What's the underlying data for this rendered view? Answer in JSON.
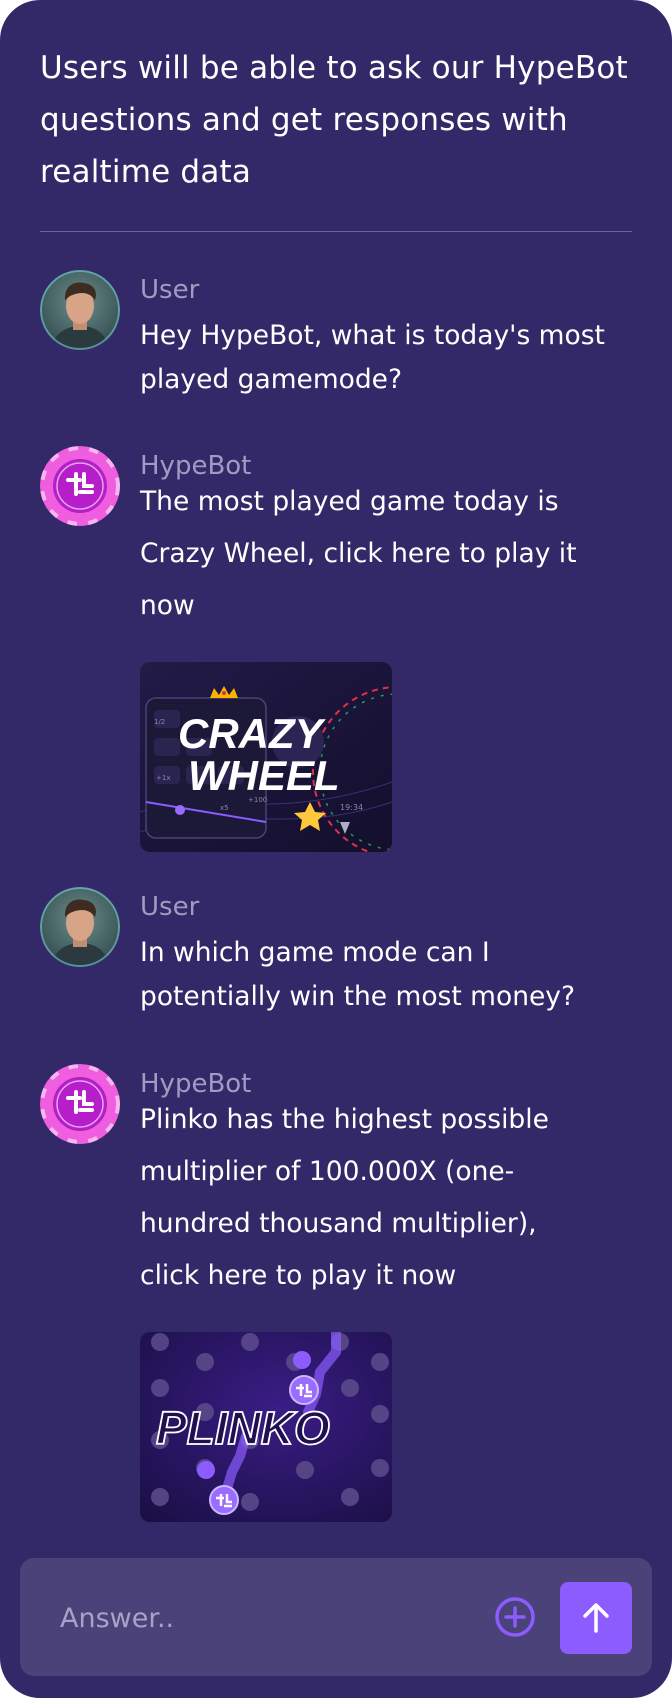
{
  "intro": {
    "line1": "Users will be able to ask our HypeBot",
    "line2": "questions and get responses with",
    "line3": "realtime data"
  },
  "messages": [
    {
      "sender": "User",
      "lines": [
        "Hey HypeBot, what is today's most",
        "played gamemode?"
      ]
    },
    {
      "sender": "HypeBot",
      "lines": [
        "The most played game today is",
        "Crazy Wheel, click here to play it",
        "now"
      ],
      "card": {
        "title_line1": "CRAZY",
        "title_line2": "WHEEL",
        "small_labels": [
          "1/2",
          "+1x",
          "x5",
          "+100",
          "19:34"
        ]
      }
    },
    {
      "sender": "User",
      "lines": [
        "In which game mode can I",
        "potentially win the most money?"
      ]
    },
    {
      "sender": "HypeBot",
      "lines": [
        "Plinko has the highest possible",
        "multiplier of 100.000X (one-",
        "hundred thousand multiplier),",
        "click here to play it now"
      ],
      "card": {
        "title": "PLINKO"
      }
    }
  ],
  "composer": {
    "placeholder": "Answer..",
    "value": ""
  },
  "icons": {
    "attach": "plus-circle-icon",
    "send": "arrow-up-icon"
  },
  "colors": {
    "background": "#332968",
    "composer": "#4b427a",
    "accent": "#8c5cff",
    "sender_label": "#a09bc0"
  }
}
